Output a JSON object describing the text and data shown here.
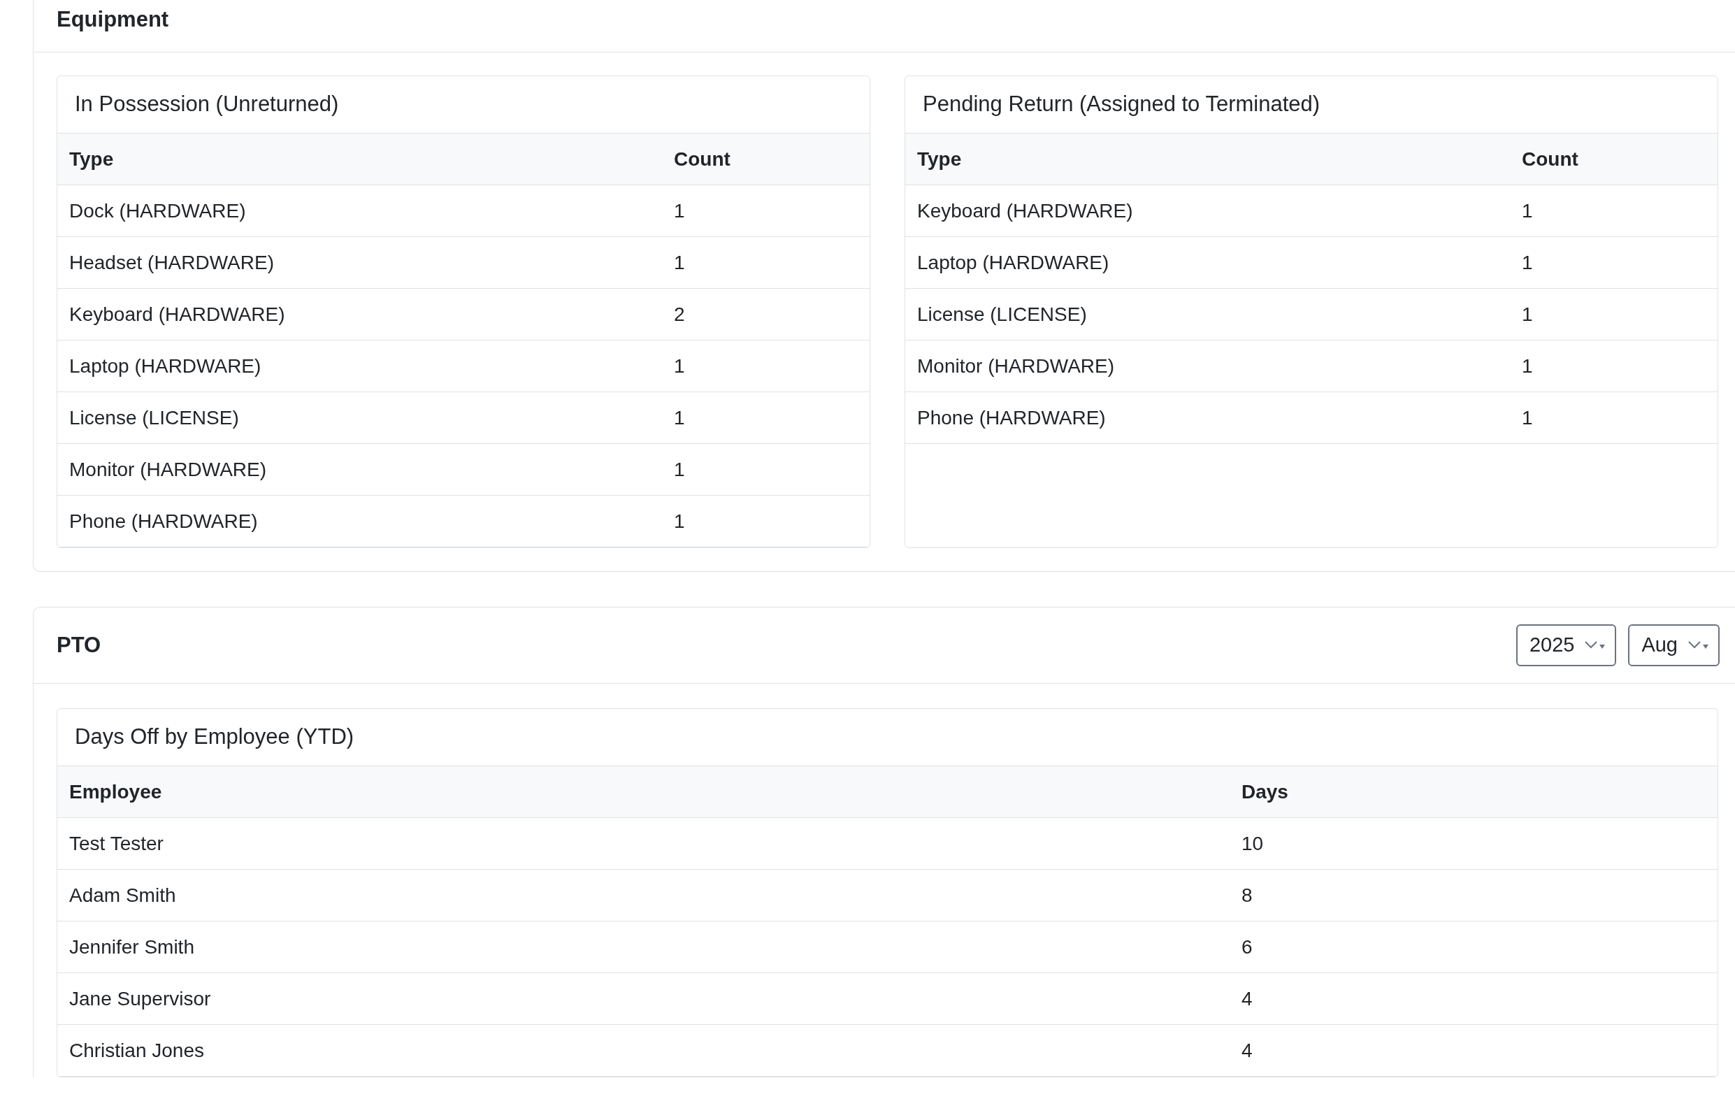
{
  "equipment": {
    "title": "Equipment",
    "panels": [
      {
        "title": "In Possession (Unreturned)",
        "columns": [
          "Type",
          "Count"
        ],
        "rows": [
          [
            "Dock (HARDWARE)",
            "1"
          ],
          [
            "Headset (HARDWARE)",
            "1"
          ],
          [
            "Keyboard (HARDWARE)",
            "2"
          ],
          [
            "Laptop (HARDWARE)",
            "1"
          ],
          [
            "License (LICENSE)",
            "1"
          ],
          [
            "Monitor (HARDWARE)",
            "1"
          ],
          [
            "Phone (HARDWARE)",
            "1"
          ]
        ]
      },
      {
        "title": "Pending Return (Assigned to Terminated)",
        "columns": [
          "Type",
          "Count"
        ],
        "rows": [
          [
            "Keyboard (HARDWARE)",
            "1"
          ],
          [
            "Laptop (HARDWARE)",
            "1"
          ],
          [
            "License (LICENSE)",
            "1"
          ],
          [
            "Monitor (HARDWARE)",
            "1"
          ],
          [
            "Phone (HARDWARE)",
            "1"
          ]
        ]
      }
    ]
  },
  "pto": {
    "title": "PTO",
    "filters": [
      {
        "value": "2025"
      },
      {
        "value": "Aug"
      }
    ],
    "panel": {
      "title": "Days Off by Employee (YTD)",
      "columns": [
        "Employee",
        "Days"
      ],
      "rows": [
        [
          "Test Tester",
          "10"
        ],
        [
          "Adam Smith",
          "8"
        ],
        [
          "Jennifer Smith",
          "6"
        ],
        [
          "Jane Supervisor",
          "4"
        ],
        [
          "Christian Jones",
          "4"
        ]
      ]
    }
  }
}
